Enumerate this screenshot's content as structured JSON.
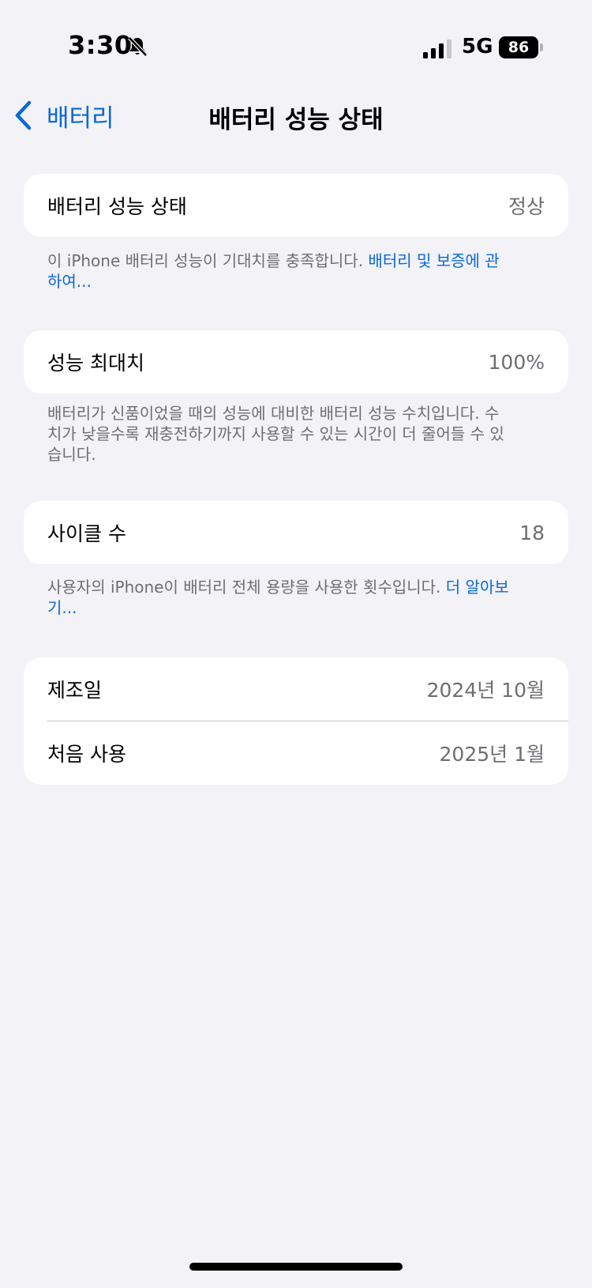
{
  "status_bar": {
    "time": "3:30",
    "network": "5G",
    "battery": "86"
  },
  "nav": {
    "back_label": "배터리",
    "title": "배터리 성능 상태"
  },
  "health": {
    "label": "배터리 성능 상태",
    "value": "정상",
    "note": "이 iPhone 배터리 성능이 기대치를 충족합니다. ",
    "note_link": "배터리 및 보증에 관하여..."
  },
  "max_capacity": {
    "label": "성능 최대치",
    "value": "100%",
    "note": "배터리가 신품이었을 때의 성능에 대비한 배터리 성능 수치입니다. 수치가 낮을수록 재충전하기까지 사용할 수 있는 시간이 더 줄어들 수 있습니다."
  },
  "cycle_count": {
    "label": "사이클 수",
    "value": "18",
    "note": "사용자의 iPhone이 배터리 전체 용량을 사용한 횟수입니다. ",
    "note_link": "더 알아보기..."
  },
  "dates": {
    "manufacture_label": "제조일",
    "manufacture_value": "2024년 10월",
    "first_use_label": "처음 사용",
    "first_use_value": "2025년 1월"
  }
}
